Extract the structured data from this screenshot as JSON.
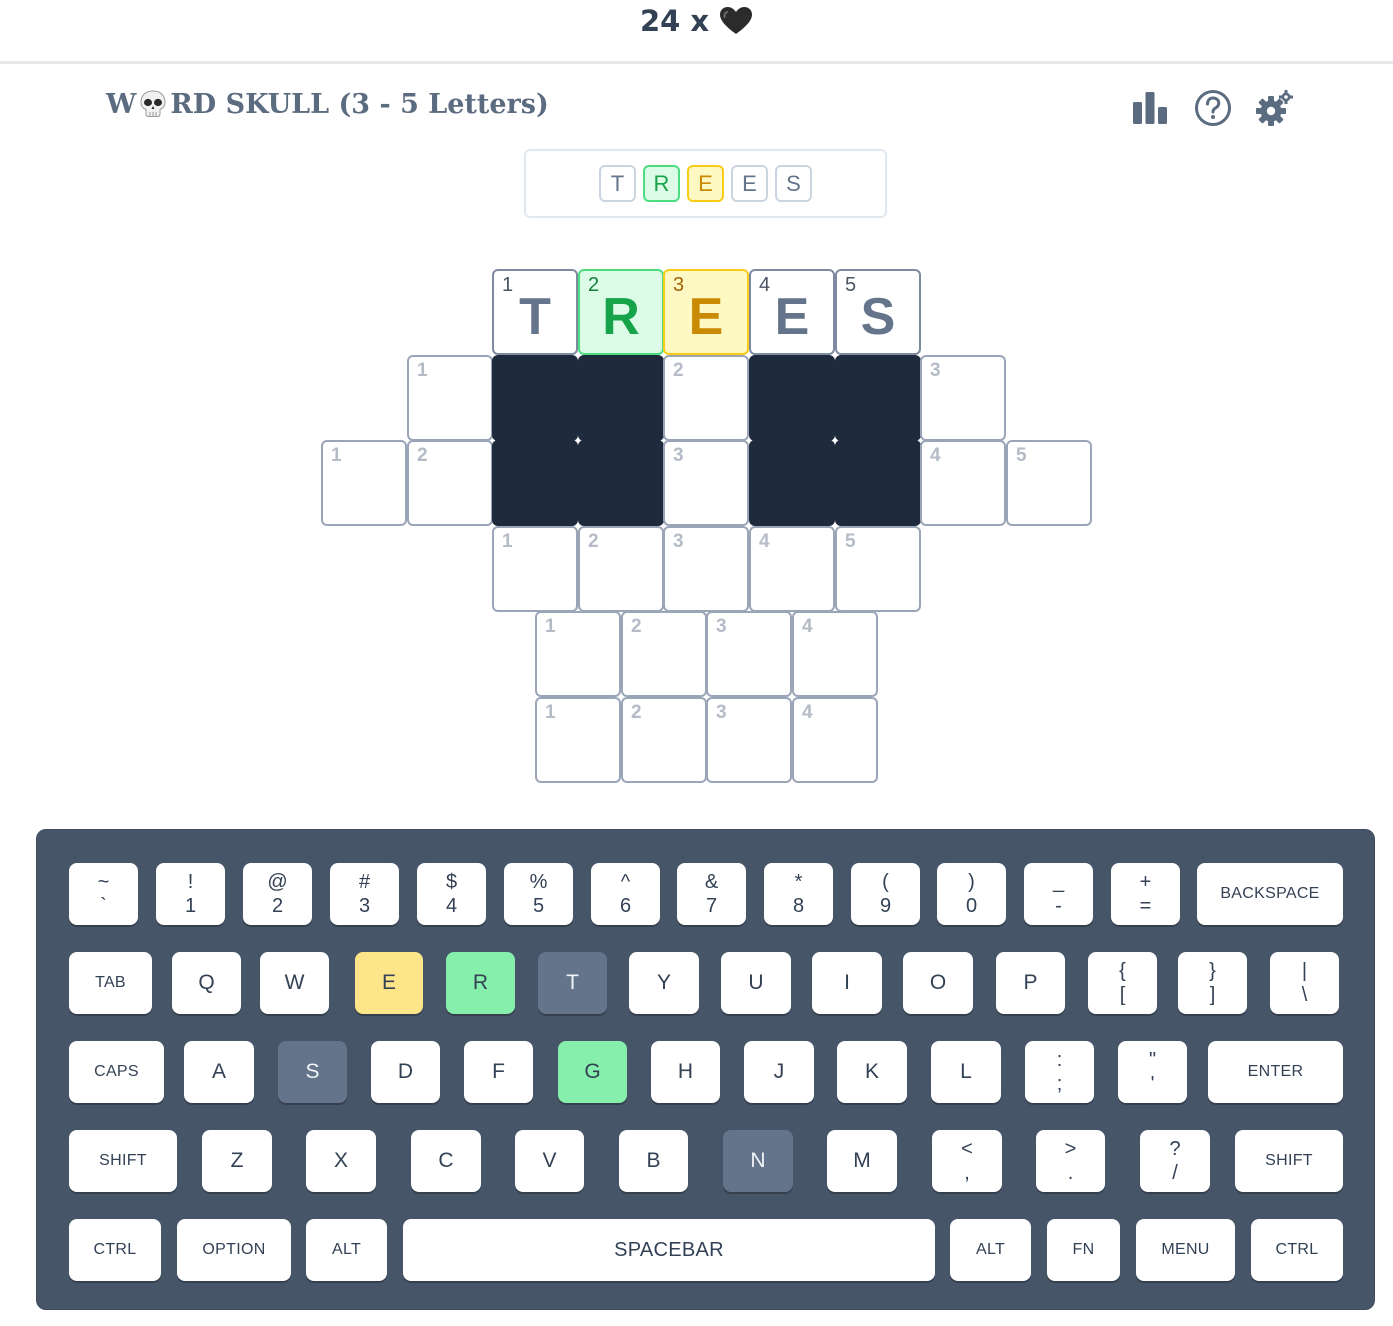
{
  "status": {
    "lives": "24",
    "times": "x",
    "heart_icon": "black-heart-icon"
  },
  "header": {
    "title_prefix": "W",
    "title_suffix": "RD SKULL (3 - 5 Letters)",
    "skull_icon": "skull-icon",
    "icons": [
      "stats-icon",
      "help-icon",
      "settings-icon"
    ]
  },
  "guess": {
    "letters": [
      {
        "letter": "T",
        "state": "absent"
      },
      {
        "letter": "R",
        "state": "correct"
      },
      {
        "letter": "E",
        "state": "present"
      },
      {
        "letter": "E",
        "state": "absent"
      },
      {
        "letter": "S",
        "state": "absent"
      }
    ]
  },
  "grid": {
    "rows": [
      {
        "cells": [
          {
            "col": 2,
            "num": "1",
            "letter": "T",
            "state": "filled"
          },
          {
            "col": 3,
            "num": "2",
            "letter": "R",
            "state": "green"
          },
          {
            "col": 4,
            "num": "3",
            "letter": "E",
            "state": "yellow"
          },
          {
            "col": 5,
            "num": "4",
            "letter": "E",
            "state": "filled"
          },
          {
            "col": 6,
            "num": "5",
            "letter": "S",
            "state": "filled"
          }
        ]
      },
      {
        "cells": [
          {
            "col": 1,
            "num": "1",
            "letter": "",
            "state": "empty"
          },
          {
            "col": 2,
            "num": "",
            "letter": "",
            "state": "black"
          },
          {
            "col": 3,
            "num": "",
            "letter": "",
            "state": "black"
          },
          {
            "col": 4,
            "num": "2",
            "letter": "",
            "state": "empty"
          },
          {
            "col": 5,
            "num": "",
            "letter": "",
            "state": "black"
          },
          {
            "col": 6,
            "num": "",
            "letter": "",
            "state": "black"
          },
          {
            "col": 7,
            "num": "3",
            "letter": "",
            "state": "empty"
          }
        ]
      },
      {
        "cells": [
          {
            "col": 0,
            "num": "1",
            "letter": "",
            "state": "empty"
          },
          {
            "col": 1,
            "num": "2",
            "letter": "",
            "state": "empty"
          },
          {
            "col": 2,
            "num": "",
            "letter": "",
            "state": "black"
          },
          {
            "col": 3,
            "num": "",
            "letter": "",
            "state": "black"
          },
          {
            "col": 4,
            "num": "3",
            "letter": "",
            "state": "empty"
          },
          {
            "col": 5,
            "num": "",
            "letter": "",
            "state": "black"
          },
          {
            "col": 6,
            "num": "",
            "letter": "",
            "state": "black"
          },
          {
            "col": 7,
            "num": "4",
            "letter": "",
            "state": "empty"
          },
          {
            "col": 8,
            "num": "5",
            "letter": "",
            "state": "empty"
          }
        ]
      },
      {
        "cells": [
          {
            "col": 2,
            "num": "1",
            "letter": "",
            "state": "empty"
          },
          {
            "col": 3,
            "num": "2",
            "letter": "",
            "state": "empty"
          },
          {
            "col": 4,
            "num": "3",
            "letter": "",
            "state": "empty"
          },
          {
            "col": 5,
            "num": "4",
            "letter": "",
            "state": "empty"
          },
          {
            "col": 6,
            "num": "5",
            "letter": "",
            "state": "empty"
          }
        ]
      },
      {
        "cells": [
          {
            "col": 2.5,
            "num": "1",
            "letter": "",
            "state": "empty"
          },
          {
            "col": 3.5,
            "num": "2",
            "letter": "",
            "state": "empty"
          },
          {
            "col": 4.5,
            "num": "3",
            "letter": "",
            "state": "empty"
          },
          {
            "col": 5.5,
            "num": "4",
            "letter": "",
            "state": "empty"
          }
        ]
      },
      {
        "cells": [
          {
            "col": 2.5,
            "num": "1",
            "letter": "",
            "state": "empty"
          },
          {
            "col": 3.5,
            "num": "2",
            "letter": "",
            "state": "empty"
          },
          {
            "col": 4.5,
            "num": "3",
            "letter": "",
            "state": "empty"
          },
          {
            "col": 5.5,
            "num": "4",
            "letter": "",
            "state": "empty"
          }
        ]
      }
    ]
  },
  "keyboard": {
    "rows": [
      [
        {
          "top": "~",
          "bottom": "`"
        },
        {
          "top": "!",
          "bottom": "1"
        },
        {
          "top": "@",
          "bottom": "2"
        },
        {
          "top": "#",
          "bottom": "3"
        },
        {
          "top": "$",
          "bottom": "4"
        },
        {
          "top": "%",
          "bottom": "5"
        },
        {
          "top": "^",
          "bottom": "6"
        },
        {
          "top": "&",
          "bottom": "7"
        },
        {
          "top": "*",
          "bottom": "8"
        },
        {
          "top": "(",
          "bottom": "9"
        },
        {
          "top": ")",
          "bottom": "0"
        },
        {
          "top": "_",
          "bottom": "-"
        },
        {
          "top": "+",
          "bottom": "="
        },
        {
          "label": "BACKSPACE"
        }
      ],
      [
        {
          "label": "TAB"
        },
        {
          "label": "Q"
        },
        {
          "label": "W"
        },
        {
          "label": "E",
          "state": "yellow"
        },
        {
          "label": "R",
          "state": "green"
        },
        {
          "label": "T",
          "state": "gray"
        },
        {
          "label": "Y"
        },
        {
          "label": "U"
        },
        {
          "label": "I"
        },
        {
          "label": "O"
        },
        {
          "label": "P"
        },
        {
          "top": "{",
          "bottom": "["
        },
        {
          "top": "}",
          "bottom": "]"
        },
        {
          "top": "|",
          "bottom": "\\"
        }
      ],
      [
        {
          "label": "CAPS"
        },
        {
          "label": "A"
        },
        {
          "label": "S",
          "state": "gray"
        },
        {
          "label": "D"
        },
        {
          "label": "F"
        },
        {
          "label": "G",
          "state": "green"
        },
        {
          "label": "H"
        },
        {
          "label": "J"
        },
        {
          "label": "K"
        },
        {
          "label": "L"
        },
        {
          "top": ":",
          "bottom": ";"
        },
        {
          "top": "\"",
          "bottom": "'"
        },
        {
          "label": "ENTER"
        }
      ],
      [
        {
          "label": "SHIFT"
        },
        {
          "label": "Z"
        },
        {
          "label": "X"
        },
        {
          "label": "C"
        },
        {
          "label": "V"
        },
        {
          "label": "B"
        },
        {
          "label": "N",
          "state": "gray"
        },
        {
          "label": "M"
        },
        {
          "top": "<",
          "bottom": ","
        },
        {
          "top": ">",
          "bottom": "."
        },
        {
          "top": "?",
          "bottom": "/"
        },
        {
          "label": "SHIFT"
        }
      ],
      [
        {
          "label": "CTRL"
        },
        {
          "label": "OPTION"
        },
        {
          "label": "ALT"
        },
        {
          "label": "SPACEBAR"
        },
        {
          "label": "ALT"
        },
        {
          "label": "FN"
        },
        {
          "label": "MENU"
        },
        {
          "label": "CTRL"
        }
      ]
    ]
  },
  "colors": {
    "correct": "#4ade80",
    "present": "#facc15",
    "absent": "#64748b",
    "black_cell": "#1f2a3c",
    "keyboard_bg": "#475569"
  }
}
